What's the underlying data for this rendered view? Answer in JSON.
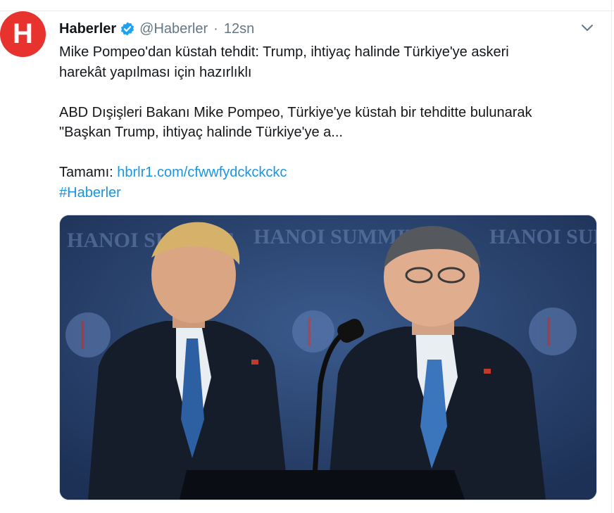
{
  "tweet": {
    "avatar_letter": "H",
    "display_name": "Haberler",
    "handle": "@Haberler",
    "separator": "·",
    "time": "12sn",
    "headline_line1": "Mike Pompeo'dan küstah tehdit: Trump, ihtiyaç halinde Türkiye'ye askeri",
    "headline_line2": "harekât yapılması için hazırlıklı",
    "summary_line1": "ABD Dışişleri Bakanı Mike Pompeo, Türkiye'ye küstah bir tehditte bulunarak",
    "summary_line2": "\"Başkan Trump, ihtiyaç halinde Türkiye'ye a...",
    "full_label": "Tamamı:",
    "link_text": "hbrlr1.com/cfwwfydckckckc",
    "hashtag": "#Haberler"
  },
  "media": {
    "backdrop_text_left": "HANOI SUMMIT",
    "backdrop_text_center": "HANOI SUMMIT",
    "backdrop_text_right": "HANOI SUMMIT"
  },
  "colors": {
    "avatar_bg": "#e8322e",
    "link": "#1b95e0",
    "verified": "#1da1f2",
    "muted": "#657786"
  }
}
